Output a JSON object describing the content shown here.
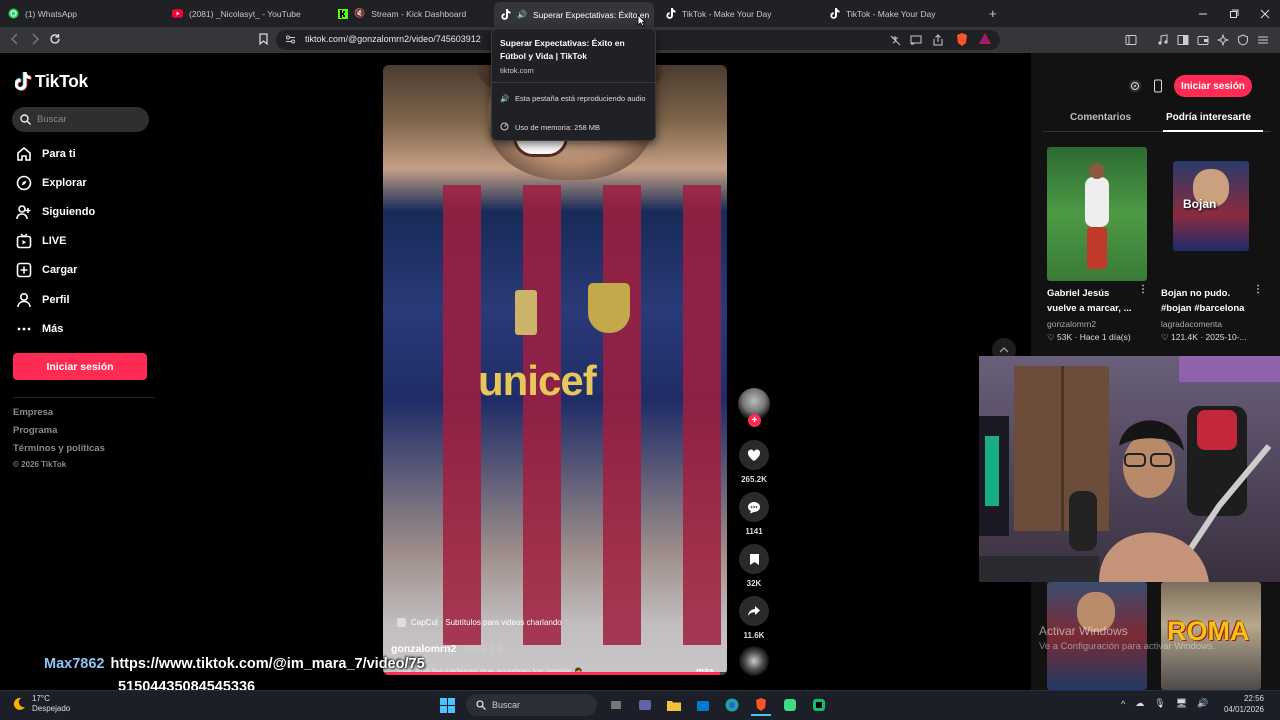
{
  "browser": {
    "tabs": [
      {
        "label": "(1) WhatsApp",
        "icon": "whatsapp-icon",
        "color": "#25d366"
      },
      {
        "label": "(2081) _Nicolasyt_ - YouTube",
        "icon": "youtube-icon",
        "color": "#ff0033"
      },
      {
        "label": "Stream - Kick Dashboard",
        "icon": "kick-icon",
        "color": "#53fc18"
      },
      {
        "label": "Superar Expectativas: Éxito en",
        "icon": "tiktok-icon",
        "color": "#ffffff"
      },
      {
        "label": "TikTok - Make Your Day",
        "icon": "tiktok-icon",
        "color": "#ffffff"
      },
      {
        "label": "TikTok - Make Your Day",
        "icon": "tiktok-icon",
        "color": "#ffffff"
      }
    ],
    "url": "tiktok.com/@gonzalomrn2/video/745603912",
    "tooltip": {
      "title": "Superar Expectativas: Éxito en Fútbol y Vida | TikTok",
      "domain": "tiktok.com",
      "audio": "Esta pestaña está reproduciendo audio",
      "memory": "Uso de memoria: 258 MB"
    }
  },
  "sidebar": {
    "logo": "TikTok",
    "search_placeholder": "Buscar",
    "nav": [
      {
        "label": "Para ti",
        "icon": "home-icon"
      },
      {
        "label": "Explorar",
        "icon": "compass-icon"
      },
      {
        "label": "Siguiendo",
        "icon": "following-icon"
      },
      {
        "label": "LIVE",
        "icon": "live-icon"
      },
      {
        "label": "Cargar",
        "icon": "upload-icon"
      },
      {
        "label": "Perfil",
        "icon": "profile-icon"
      },
      {
        "label": "Más",
        "icon": "more-icon"
      }
    ],
    "login": "Iniciar sesión",
    "footer": [
      "Empresa",
      "Programa",
      "Términos y políticas"
    ],
    "copyright": "© 2026 TikTok"
  },
  "video": {
    "jersey_text": "unicef",
    "capcut": "CapCut · Subtítulos para videos charlando",
    "author": "gonzalomrn2",
    "date": " · 2025-1-4",
    "description": "...vas, son las cadenas que arrastran los genios 🙇 ...",
    "more": "más",
    "progress": 0.98,
    "likes": "265.2K",
    "comments": "1141",
    "saves": "32K",
    "shares": "11.6K"
  },
  "right_panel": {
    "login": "Iniciar sesión",
    "tabs": [
      "Comentarios",
      "Podría interesarte"
    ],
    "cards": [
      {
        "title": "Gabriel Jesús vuelve a marcar, ...",
        "author": "gonzalomrn2",
        "likes": "53K",
        "time": "Hace 1 día(s)"
      },
      {
        "title": "Bojan no pudo. #bojan #barcelona",
        "author": "lagradacomenta",
        "likes": "121.4K",
        "time": "2025-10-...",
        "thumb_text": "Bojan"
      },
      {
        "thumb_text": ""
      },
      {
        "thumb_text": "ROMA"
      }
    ]
  },
  "overlay": {
    "user": "Max7862",
    "message": "https://www.tiktok.com/@im_mara_7/video/75",
    "message2": "51504435084545336"
  },
  "watermark": {
    "line1": "Activar Windows",
    "line2": "Ve a Configuración para activar Windows."
  },
  "taskbar": {
    "temp": "17°C",
    "weather": "Despejado",
    "search": "Buscar",
    "time": "22:56",
    "date": "04/01/2026"
  }
}
